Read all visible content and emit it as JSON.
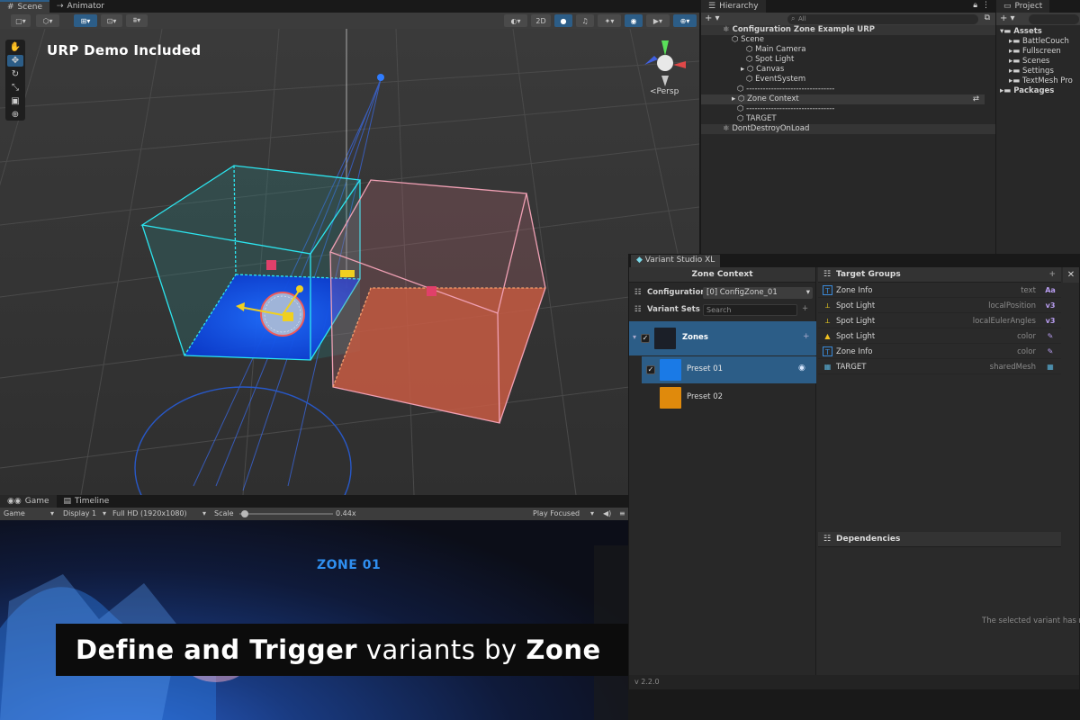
{
  "scene": {
    "tabs": [
      {
        "label": "Scene"
      },
      {
        "label": "Animator"
      }
    ],
    "toolbar": {
      "mode_2d": "2D"
    },
    "overlay_heading": "URP Demo Included",
    "persp_label": "<Persp"
  },
  "hierarchy": {
    "tab": "Hierarchy",
    "add": "+ ▾",
    "search_placeholder": "All",
    "rows": [
      {
        "label": "Configuration Zone Example URP"
      },
      {
        "label": "Scene"
      },
      {
        "label": "Main Camera"
      },
      {
        "label": "Spot Light"
      },
      {
        "label": "Canvas"
      },
      {
        "label": "EventSystem"
      },
      {
        "label": "--------------------------------"
      },
      {
        "label": "Zone Context"
      },
      {
        "label": "--------------------------------"
      },
      {
        "label": "TARGET"
      },
      {
        "label": "DontDestroyOnLoad"
      }
    ]
  },
  "project": {
    "tab": "Project",
    "add": "+ ▾",
    "items": [
      {
        "label": "Assets"
      },
      {
        "label": "BattleCouch"
      },
      {
        "label": "Fullscreen"
      },
      {
        "label": "Scenes"
      },
      {
        "label": "Settings"
      },
      {
        "label": "TextMesh Pro"
      },
      {
        "label": "Packages"
      }
    ]
  },
  "game": {
    "tabs": [
      {
        "label": "Game"
      },
      {
        "label": "Timeline"
      }
    ],
    "toolbar": {
      "game": "Game",
      "display": "Display 1",
      "resolution": "Full HD (1920x1080)",
      "scale_label": "Scale",
      "scale_value": "0.44x",
      "play_mode": "Play Focused"
    },
    "zone_label": "ZONE 01",
    "scale_fraction": 0.44
  },
  "banner": {
    "bold_text": "Define and Trigger",
    "middle_text": " variants by ",
    "end_text": "Zone"
  },
  "variant_studio": {
    "tab": "Variant Studio XL",
    "left_title": "Zone Context",
    "configuration_label": "Configuration",
    "configuration_value": "[0] ConfigZone_01",
    "variant_sets_label": "Variant Sets",
    "search_placeholder": "Search",
    "zones_label": "Zones",
    "variants": [
      {
        "label": "Preset 01",
        "color": "#1a7ae6"
      },
      {
        "label": "Preset 02",
        "color": "#e08a0c"
      }
    ],
    "target_groups_title": "Target Groups",
    "target_groups": [
      {
        "name": "Zone Info",
        "property": "text",
        "type_icon": "Aa"
      },
      {
        "name": "Spot Light",
        "property": "localPosition",
        "type_icon": "v3"
      },
      {
        "name": "Spot Light",
        "property": "localEulerAngles",
        "type_icon": "v3"
      },
      {
        "name": "Spot Light",
        "property": "color",
        "type_icon": "color-icon"
      },
      {
        "name": "Zone Info",
        "property": "color",
        "type_icon": "color-icon"
      },
      {
        "name": "TARGET",
        "property": "sharedMesh",
        "type_icon": "mesh-icon"
      }
    ],
    "dependencies_title": "Dependencies",
    "dependencies_message": "The selected variant has no",
    "version": "v 2.2.0"
  },
  "colors": {
    "accent_blue": "#2c5d87",
    "zone_cyan": "#2ce6f0",
    "zone_pink": "#f0a0b4",
    "zone_label": "#2f8ff0"
  }
}
